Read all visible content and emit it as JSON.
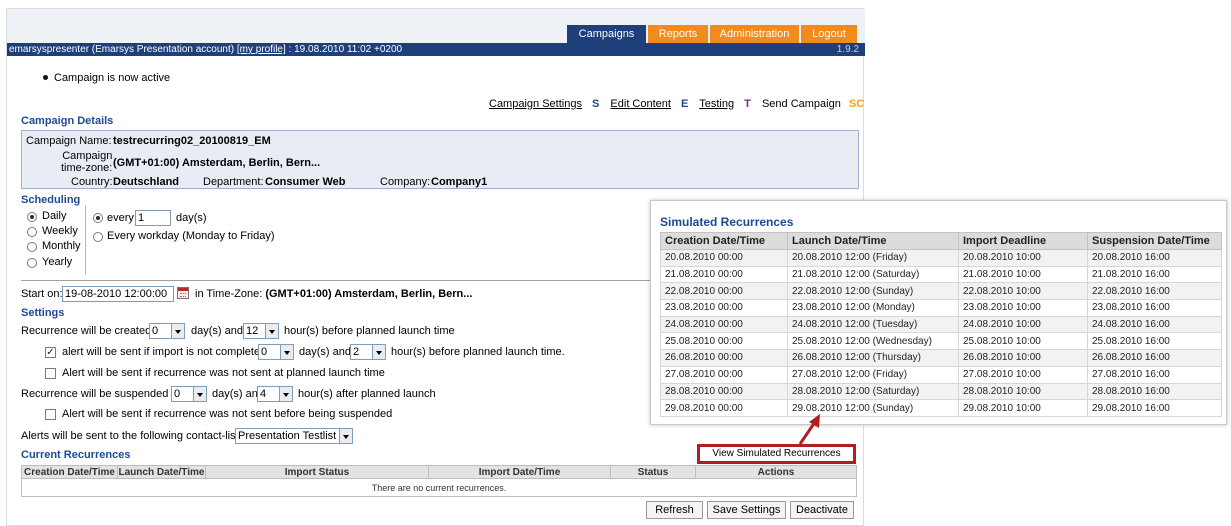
{
  "nav": {
    "tabs": [
      {
        "label": "Campaigns",
        "active": true
      },
      {
        "label": "Reports",
        "active": false
      },
      {
        "label": "Administration",
        "active": false
      },
      {
        "label": "Logout",
        "active": false
      }
    ],
    "active_color": "#1e3f7a",
    "inactive_color": "#f28b1e"
  },
  "userbar": {
    "user": "emarsyspresenter (Emarsys Presentation account)",
    "profile_link": "[my profile]",
    "datetime": ": 19.08.2010 11:02 +0200",
    "version": "1.9.2"
  },
  "status_message": "Campaign is now active",
  "steps": {
    "settings": "Campaign Settings",
    "settings_key": "S",
    "content": "Edit Content",
    "content_key": "E",
    "testing": "Testing",
    "testing_key": "T",
    "send": "Send Campaign",
    "send_key": "SC"
  },
  "details": {
    "heading": "Campaign Details",
    "name_label": "Campaign Name:",
    "name_value": "testrecurring02_20100819_EM",
    "tz_label_1": "Campaign",
    "tz_label_2": "time-zone:",
    "tz_value": "(GMT+01:00) Amsterdam, Berlin, Bern...",
    "country_label": "Country:",
    "country_value": "Deutschland",
    "department_label": "Department:",
    "department_value": "Consumer Web",
    "company_label": "Company:",
    "company_value": "Company1"
  },
  "scheduling": {
    "heading": "Scheduling",
    "frequencies": [
      "Daily",
      "Weekly",
      "Monthly",
      "Yearly"
    ],
    "selected_frequency": "Daily",
    "every_label": "every",
    "every_value": "1",
    "days_label": "day(s)",
    "workday_label": "Every workday (Monday to Friday)"
  },
  "start": {
    "label": "Start on:",
    "value": "19-08-2010 12:00:00",
    "tz_prefix": "in Time-Zone:",
    "tz_value": "(GMT+01:00) Amsterdam, Berlin, Bern..."
  },
  "settings": {
    "heading": "Settings",
    "created_prefix": "Recurrence will be created",
    "created_days": "0",
    "days_and": "day(s) and",
    "created_hours": "12",
    "created_suffix": "hour(s) before planned launch time",
    "alert_import_label": "alert will be sent if import is not completed",
    "alert_import_days": "0",
    "alert_import_hours": "2",
    "alert_import_suffix": "hour(s) before planned launch time.",
    "alert_not_sent_label": "Alert will be sent if recurrence was not sent at planned launch time",
    "suspended_prefix": "Recurrence will be suspended",
    "suspended_days": "0",
    "suspended_hours": "4",
    "suspended_suffix": "hour(s) after planned launch",
    "alert_suspended_label": "Alert will be sent if recurrence was not sent before being suspended",
    "contact_list_label": "Alerts will be sent to the following contact-list:",
    "contact_list_value": "Presentation Testlist"
  },
  "current": {
    "heading": "Current Recurrences",
    "columns": [
      "Creation Date/Time",
      "Launch Date/Time",
      "Import Status",
      "Import Date/Time",
      "Status",
      "Actions"
    ],
    "empty": "There are no current recurrences."
  },
  "buttons": {
    "view_simulated": "View Simulated Recurrences",
    "refresh": "Refresh",
    "save": "Save Settings",
    "deactivate": "Deactivate"
  },
  "simulated": {
    "title": "Simulated Recurrences",
    "columns": [
      "Creation Date/Time",
      "Launch Date/Time",
      "Import Deadline",
      "Suspension Date/Time"
    ],
    "rows": [
      [
        "20.08.2010 00:00",
        "20.08.2010 12:00 (Friday)",
        "20.08.2010 10:00",
        "20.08.2010 16:00"
      ],
      [
        "21.08.2010 00:00",
        "21.08.2010 12:00 (Saturday)",
        "21.08.2010 10:00",
        "21.08.2010 16:00"
      ],
      [
        "22.08.2010 00:00",
        "22.08.2010 12:00 (Sunday)",
        "22.08.2010 10:00",
        "22.08.2010 16:00"
      ],
      [
        "23.08.2010 00:00",
        "23.08.2010 12:00 (Monday)",
        "23.08.2010 10:00",
        "23.08.2010 16:00"
      ],
      [
        "24.08.2010 00:00",
        "24.08.2010 12:00 (Tuesday)",
        "24.08.2010 10:00",
        "24.08.2010 16:00"
      ],
      [
        "25.08.2010 00:00",
        "25.08.2010 12:00 (Wednesday)",
        "25.08.2010 10:00",
        "25.08.2010 16:00"
      ],
      [
        "26.08.2010 00:00",
        "26.08.2010 12:00 (Thursday)",
        "26.08.2010 10:00",
        "26.08.2010 16:00"
      ],
      [
        "27.08.2010 00:00",
        "27.08.2010 12:00 (Friday)",
        "27.08.2010 10:00",
        "27.08.2010 16:00"
      ],
      [
        "28.08.2010 00:00",
        "28.08.2010 12:00 (Saturday)",
        "28.08.2010 10:00",
        "28.08.2010 16:00"
      ],
      [
        "29.08.2010 00:00",
        "29.08.2010 12:00 (Sunday)",
        "29.08.2010 10:00",
        "29.08.2010 16:00"
      ]
    ]
  },
  "colors": {
    "heading_blue": "#1c4a94",
    "key_s": "#1c4a94",
    "key_e": "#1c4a94",
    "key_t": "#8a1f7a",
    "key_sc": "#f0a01e",
    "callout_red": "#b11e22"
  },
  "icons": {
    "bullet": "bullet-dot-icon",
    "calendar": "calendar-icon",
    "dropdown": "chevron-down-icon",
    "check": "checkmark-icon",
    "callout": "arrow-callout-icon"
  }
}
